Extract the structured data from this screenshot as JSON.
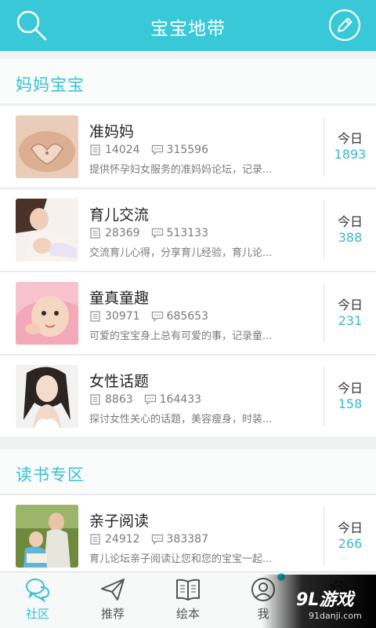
{
  "header": {
    "title": "宝宝地带",
    "left_icon": "search-icon",
    "right_icon": "edit-icon"
  },
  "sections": [
    {
      "title": "妈妈宝宝",
      "items": [
        {
          "name": "准妈妈",
          "threads": "14024",
          "replies": "315596",
          "desc": "提供怀孕妇女服务的准妈妈论坛，记录...",
          "today_label": "今日",
          "today_count": "1893"
        },
        {
          "name": "育儿交流",
          "threads": "28369",
          "replies": "513133",
          "desc": "交流育儿心得，分享育儿经验，育儿论...",
          "today_label": "今日",
          "today_count": "388"
        },
        {
          "name": "童真童趣",
          "threads": "30971",
          "replies": "685653",
          "desc": "可爱的宝宝身上总有可爱的事，记录童...",
          "today_label": "今日",
          "today_count": "231"
        },
        {
          "name": "女性话题",
          "threads": "8863",
          "replies": "164433",
          "desc": "探讨女性关心的话题，美容瘦身，时装...",
          "today_label": "今日",
          "today_count": "158"
        }
      ]
    },
    {
      "title": "读书专区",
      "items": [
        {
          "name": "亲子阅读",
          "threads": "24912",
          "replies": "383387",
          "desc": "育儿论坛亲子阅读让您和您的宝宝一起...",
          "today_label": "今日",
          "today_count": "266"
        }
      ]
    }
  ],
  "tabs": [
    {
      "label": "社区",
      "icon": "chat-bubbles-icon",
      "active": true
    },
    {
      "label": "推荐",
      "icon": "paper-plane-icon",
      "active": false
    },
    {
      "label": "绘本",
      "icon": "book-icon",
      "active": false
    },
    {
      "label": "我",
      "icon": "user-icon",
      "active": false
    },
    {
      "label": "",
      "icon": "gear-icon",
      "active": false
    }
  ],
  "watermark": {
    "main": "9L游戏",
    "sub": "91danji.com"
  },
  "colors": {
    "accent": "#38c8d8",
    "accent_text": "#38c0d2"
  }
}
